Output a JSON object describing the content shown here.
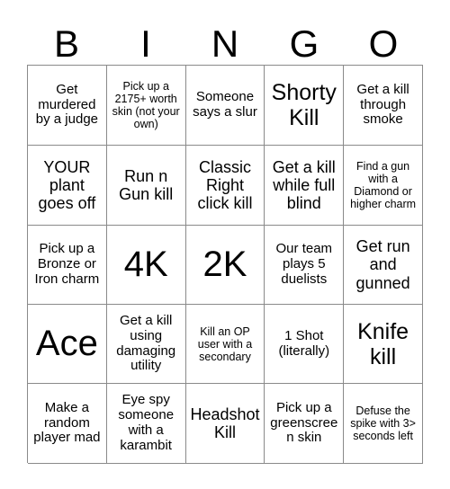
{
  "card": {
    "header_letters": [
      "B",
      "I",
      "N",
      "G",
      "O"
    ],
    "rows": [
      [
        {
          "text": "Get murdered by a judge",
          "size": "sm"
        },
        {
          "text": "Pick up a 2175+ worth skin (not your own)",
          "size": "xs"
        },
        {
          "text": "Someone says a slur",
          "size": "sm"
        },
        {
          "text": "Shorty Kill",
          "size": "xl"
        },
        {
          "text": "Get a kill through smoke",
          "size": "sm"
        }
      ],
      [
        {
          "text": "YOUR plant goes off",
          "size": "md"
        },
        {
          "text": "Run n Gun kill",
          "size": "md"
        },
        {
          "text": "Classic Right click kill",
          "size": "md"
        },
        {
          "text": "Get a kill while full blind",
          "size": "md"
        },
        {
          "text": "Find a gun with a Diamond or higher charm",
          "size": "xs"
        }
      ],
      [
        {
          "text": "Pick up a Bronze or Iron charm",
          "size": "sm"
        },
        {
          "text": "4K",
          "size": "xxl"
        },
        {
          "text": "2K",
          "size": "xxl"
        },
        {
          "text": "Our team plays 5 duelists",
          "size": "sm"
        },
        {
          "text": "Get run and gunned",
          "size": "md"
        }
      ],
      [
        {
          "text": "Ace",
          "size": "xxl"
        },
        {
          "text": "Get a kill using damaging utility",
          "size": "sm"
        },
        {
          "text": "Kill an OP user with a secondary",
          "size": "xs"
        },
        {
          "text": "1 Shot (literally)",
          "size": "sm"
        },
        {
          "text": "Knife kill",
          "size": "xl"
        }
      ],
      [
        {
          "text": "Make a random player mad",
          "size": "sm"
        },
        {
          "text": "Eye spy someone with a karambit",
          "size": "sm"
        },
        {
          "text": "Headshot Kill",
          "size": "md"
        },
        {
          "text": "Pick up a greenscreen skin",
          "size": "sm"
        },
        {
          "text": "Defuse the spike with 3> seconds left",
          "size": "xs"
        }
      ]
    ]
  }
}
